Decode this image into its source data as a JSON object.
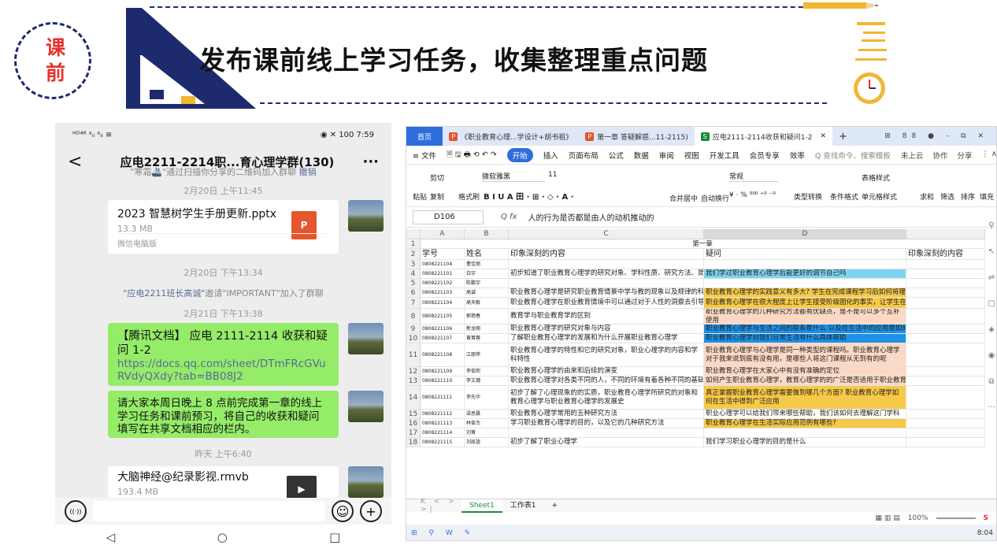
{
  "slide": {
    "title": "发布课前线上学习任务，收集整理重点问题",
    "badge_top": "课",
    "badge_bottom": "前"
  },
  "phone": {
    "status_left": "ᴴᴰ⁴⁶ ᵃᵢₗ ᵃᵢₗ ≋",
    "status_right": "◉ ✕ 100 7:59",
    "chat_title": "应电2211-2214职...育心理学群(130)",
    "back_icon": "<",
    "more_icon": "···",
    "sys1_a": "\"寒霜🚢\"通过扫描你分享的二维码加入群聊",
    "sys1_b": "撤销",
    "time1": "2月20日 上午11:45",
    "file1_name": "2023 智慧树学生手册更新.pptx",
    "file1_size": "13.3 MB",
    "file1_source": "微信电脑版",
    "file1_icon": "P",
    "time2": "2月20日 下午13:34",
    "sys2_a": "\"应电2211班长高诚\"",
    "sys2_b": "邀请\"IMPORTANT\"加入了群聊",
    "time3": "2月21日 下午13:38",
    "msg1_head": "【腾讯文档】 应电 2111-2114 收获和疑问 1-2",
    "msg1_link": "https://docs.qq.com/sheet/DTmFRcGVuRVdyQXdy?tab=BB08J2",
    "msg2": "请大家本周日晚上 8 点前完成第一章的线上学习任务和课前预习，将自己的收获和疑问填写在共享文档相应的栏内。",
    "time4": "昨天 上午6:40",
    "file2_name": "大脑神经@纪录影视.rmvb",
    "file2_size": "193.4 MB",
    "voice_icon": "((·))",
    "emoji_icon": "☺",
    "plus_icon": "+",
    "nav": [
      "◁",
      "○",
      "□"
    ]
  },
  "sheet": {
    "tabs": {
      "home": "首页",
      "t1": "《职业教育心理...学设计+胡书祖》",
      "t2": "第一章 答疑解惑...11-2115)",
      "t3": "应电2111-2114收获和疑问1-2",
      "right": "⊞ 88 ● – ⧉ ✕"
    },
    "menu": [
      "≡ 文件",
      "🗎 🖫 🖶 ⟲ ↶ ↷",
      "开始",
      "插入",
      "页面布局",
      "公式",
      "数据",
      "审阅",
      "视图",
      "开发工具",
      "会员专享",
      "效率",
      "Q 查找命令、搜索模板"
    ],
    "menu_right": [
      "未上云",
      "协作",
      "分享",
      "⋮ ∧"
    ],
    "ribbon": {
      "cut": "剪切",
      "paste": "粘贴",
      "copy": "复制",
      "format_painter": "格式刷",
      "font": "微软雅黑",
      "size": "11",
      "bold_row": "B I U A 田 · ⊞ · ◇ · A ·",
      "merge": "合并居中",
      "wrap": "自动换行",
      "num_format": "常规",
      "currency": "¥ · % ⁰⁰⁰ ⁺⁰ ⁻⁰",
      "type_convert": "类型转换",
      "cond_format": "条件格式",
      "table_style": "表格样式",
      "cell_style": "单元格样式",
      "sum": "求和",
      "filter": "筛选",
      "sort": "排序",
      "fill": "填充"
    },
    "cell_ref": "D106",
    "formula": "人的行为是否都是由人的动机推动的",
    "cols": [
      "A",
      "B",
      "C",
      "D"
    ],
    "headers": {
      "r1": "第一章",
      "a": "学号",
      "b": "姓名",
      "c": "印象深刻的内容",
      "d": "疑问",
      "e": "印象深刻的内容"
    },
    "rows": [
      {
        "n": "3",
        "a": "0808221104",
        "b": "董佳丽",
        "c": "",
        "d": "",
        "dbg": ""
      },
      {
        "n": "4",
        "a": "0808221101",
        "b": "白宇",
        "c": "初步知道了职业教育心理学的研究对象、学科性质、研究方法、简要历史",
        "d": "我们学过职业教育心理学后能更好的调节自己吗",
        "dbg": "#7ed4f0"
      },
      {
        "n": "5",
        "a": "0808221102",
        "b": "陈鹏宇",
        "c": "",
        "d": "",
        "dbg": ""
      },
      {
        "n": "6",
        "a": "0808221103",
        "b": "高诚",
        "c": "职业教育心理学是研究职业教育情景中学与教的现象以及规律的科学",
        "d": "职业教育心理学的实践意义有多大? 学生在完成课程学习后如何将理论与实践相结合?",
        "dbg": "#f7c948"
      },
      {
        "n": "7",
        "a": "0808221104",
        "b": "高天敏",
        "c": "职业教育心理学在职业教育情境中可以通过对于人性的洞察去引导他们",
        "d": "职业教育心理学在很大程度上让学生接受阶级固化的事实，让学生在职业技术中所获得的精神价值",
        "dbg": "#f7c948"
      },
      {
        "n": "8",
        "a": "0808221105",
        "b": "郭艳春",
        "c": "教育学与职业教育学的区别",
        "d": "职业教育心理学的几种研究方法都有优缺点，是不是可以多个互补使用",
        "dbg": "#fcd9c4"
      },
      {
        "n": "9",
        "a": "0808221106",
        "b": "新龙翔",
        "c": "职业教育心理学的研究对象与内容",
        "d": "职业教育心理学与生活之间的联系是什么 以及在生活中的应用是如何的",
        "dbg": "#1e90e6"
      },
      {
        "n": "10",
        "a": "0808221107",
        "b": "黄菁蓉",
        "c": "了解职业教育心理学的发展和为什么开展职业教育心理学",
        "d": "职业教育心理学对我们日常生活有什么具体帮助",
        "dbg": "#1e90e6"
      },
      {
        "n": "11",
        "a": "0808221108",
        "b": "江丽萍",
        "c": "职业教育心理学的特性和它的研究对象，职业心理学的内容和学科特性",
        "d": "职业教育心理学与心理学是同一种类型的课程吗。职业教育心理学对于我来说到底有没有用，是哪些人将这门课程从无到有的呢",
        "dbg": "#fcd9c4"
      },
      {
        "n": "12",
        "a": "0808221109",
        "b": "李俊熙",
        "c": "职业教育心理学的由来和后续的演变",
        "d": "职业教育心理学在大家心中有没有准确的定位",
        "dbg": "#fcd9c4"
      },
      {
        "n": "13",
        "a": "0808221110",
        "b": "李文瀚",
        "c": "职业教育心理学对各类不同的人，不同的环境有着各种不同的基础研究方",
        "d": "如何产生职业教育心理学，教育心理学的的广泛是否适用于职业教育心理学，职业教育心理学是否",
        "dbg": "#fcd9c4"
      },
      {
        "n": "14",
        "a": "0808221111",
        "b": "李先华",
        "c": "初步了解了心理现象的的实质，职业教育心理学所研究的对象和教育心理学与职业教育心理学的发展史",
        "d": "真正掌握职业教育心理学需要做到哪几个方面? 职业教育心理学如何在生活中得到广泛应用",
        "dbg": "#f7c948"
      },
      {
        "n": "15",
        "a": "0808221112",
        "b": "梁思晨",
        "c": "职业教育心理学常用的五种研究方法",
        "d": "职业心理学可以给我们带来哪些帮助，我们该如何去理解这门学科",
        "dbg": ""
      },
      {
        "n": "16",
        "a": "0808221113",
        "b": "林俊杰",
        "c": "学习职业教育心理学的目的，以及它的几种研究方法",
        "d": "职业教育心理学在生活实际应用范例有哪些?",
        "dbg": "#f7c948"
      },
      {
        "n": "17",
        "a": "0808221114",
        "b": "刘菁",
        "c": "",
        "d": "",
        "dbg": ""
      },
      {
        "n": "18",
        "a": "0808221115",
        "b": "刘凯旋",
        "c": "初步了解了职业心理学",
        "d": "我们学习职业心理学的目的是什么",
        "dbg": ""
      }
    ],
    "sheet_tabs": [
      "Sheet1",
      "工作表1",
      "+"
    ],
    "sheet_nav": "K < > >|",
    "zoom": "100%",
    "tray_time": "8:04",
    "taskbar_icons": "⊞ ⚲ W ✎"
  }
}
